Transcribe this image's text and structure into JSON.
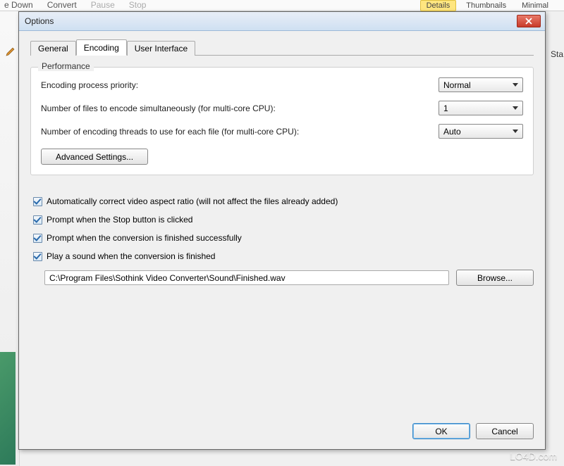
{
  "background": {
    "toolbar": [
      "e Down",
      "Convert",
      "Pause",
      "Stop"
    ],
    "view_tabs": [
      "Details",
      "Thumbnails",
      "Minimal"
    ],
    "right_label": "Sta",
    "watermark": "LO4D.com"
  },
  "dialog": {
    "title": "Options",
    "tabs": [
      "General",
      "Encoding",
      "User Interface"
    ],
    "performance": {
      "legend": "Performance",
      "priority_label": "Encoding process priority:",
      "priority_value": "Normal",
      "files_label": "Number of files to encode simultaneously (for multi-core CPU):",
      "files_value": "1",
      "threads_label": "Number of encoding threads to use for each file (for multi-core CPU):",
      "threads_value": "Auto",
      "advanced_button": "Advanced Settings..."
    },
    "checks": {
      "aspect": "Automatically correct video aspect ratio (will not affect the files already added)",
      "stop_prompt": "Prompt when the Stop button is clicked",
      "finish_prompt": "Prompt when the conversion is finished successfully",
      "play_sound": "Play a sound when the conversion is finished"
    },
    "sound_path": "C:\\Program Files\\Sothink Video Converter\\Sound\\Finished.wav",
    "browse_button": "Browse...",
    "ok_button": "OK",
    "cancel_button": "Cancel"
  }
}
